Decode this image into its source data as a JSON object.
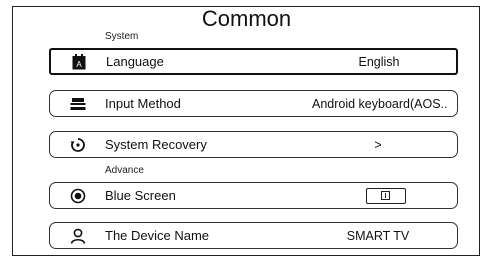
{
  "page": {
    "title": "Common"
  },
  "sections": {
    "system": "System",
    "advance": "Advance"
  },
  "rows": {
    "language": {
      "label": "Language",
      "value": "English",
      "icon": "calendar-icon"
    },
    "input_method": {
      "label": "Input Method",
      "value": "Android keyboard(AOS..",
      "icon": "keyboard-icon"
    },
    "system_recovery": {
      "label": "System Recovery",
      "value": ">",
      "icon": "recovery-icon"
    },
    "blue_screen": {
      "label": "Blue Screen",
      "icon": "radio-dot-icon",
      "toggle_state": "off"
    },
    "device_name": {
      "label": "The Device Name",
      "value": "SMART TV",
      "icon": "person-icon"
    }
  }
}
